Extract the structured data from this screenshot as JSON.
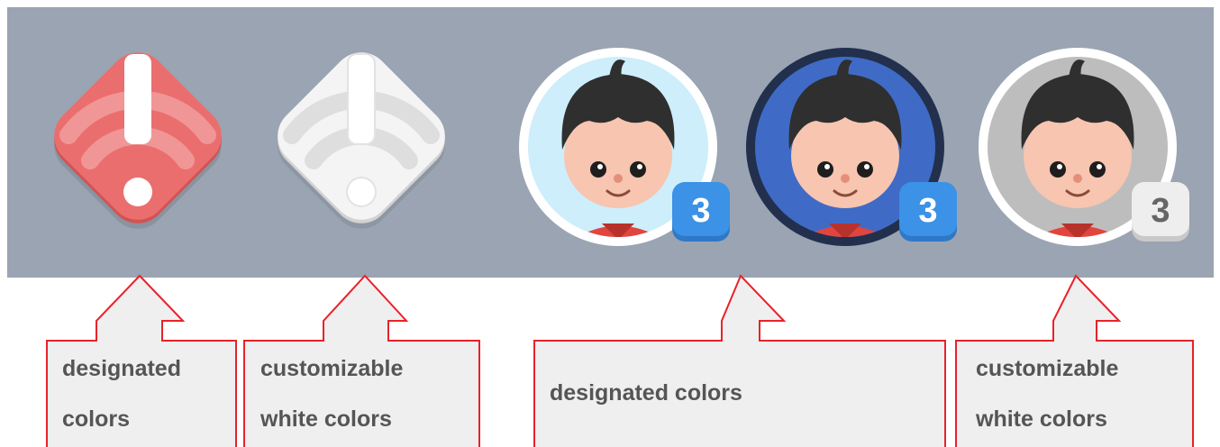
{
  "icons": [
    {
      "name": "alert-wifi-icon",
      "variant": "designated",
      "colors": {
        "fill": "#eb6e6e",
        "shade": "#d05353",
        "glyph": "#ffffff"
      }
    },
    {
      "name": "alert-wifi-icon",
      "variant": "white",
      "colors": {
        "fill": "#f4f4f4",
        "shade": "#d2d2d2",
        "glyph": "#ffffff"
      }
    },
    {
      "name": "avatar-badge-icon",
      "variant": "designated-light",
      "badge": "3",
      "colors": {
        "ring": "#ffffff",
        "bg": "#cdeefa",
        "badge": "#3b92e6",
        "badge_text": "#ffffff"
      }
    },
    {
      "name": "avatar-badge-icon",
      "variant": "designated-dark",
      "badge": "3",
      "colors": {
        "ring": "#22304d",
        "bg": "#3f6bc6",
        "badge": "#3b92e6",
        "badge_text": "#ffffff"
      }
    },
    {
      "name": "avatar-badge-icon",
      "variant": "white",
      "badge": "3",
      "colors": {
        "ring": "#ffffff",
        "bg": "#bdbdbd",
        "badge": "#eeeeee",
        "badge_text": "#666666"
      }
    }
  ],
  "callouts": [
    {
      "text": "designated\ncolors"
    },
    {
      "text": "customizable\nwhite colors"
    },
    {
      "text": "designated colors"
    },
    {
      "text": "customizable\nwhite colors"
    }
  ],
  "colors": {
    "background": "#9aa4b2",
    "callout_border": "#e8222a",
    "callout_fill": "#efefef",
    "callout_text": "#555555"
  }
}
